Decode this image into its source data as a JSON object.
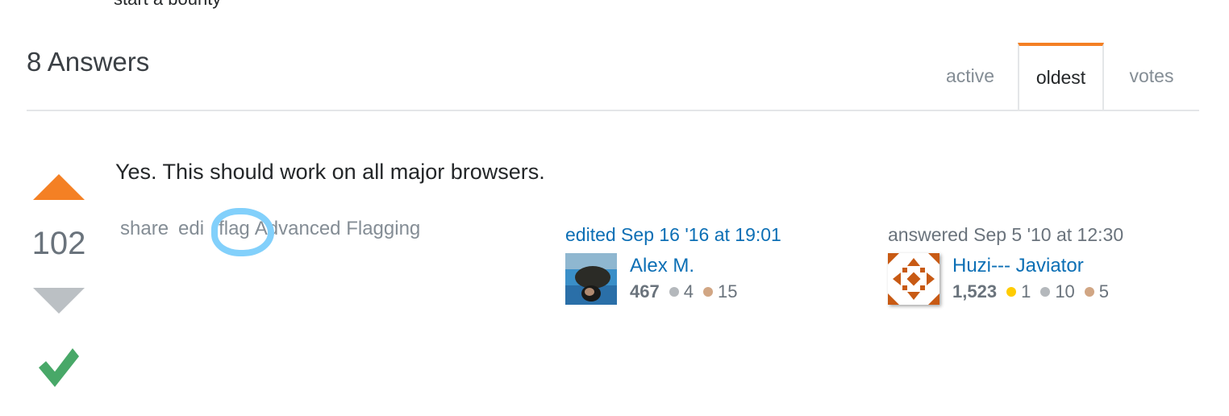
{
  "previous_text": "start a bounty",
  "answers_header": {
    "count_label": "8 Answers",
    "tabs": [
      {
        "label": "active",
        "selected": false
      },
      {
        "label": "oldest",
        "selected": true
      },
      {
        "label": "votes",
        "selected": false
      }
    ],
    "accent_color": "#f48024"
  },
  "answer": {
    "vote_count": "102",
    "accepted": true,
    "body": "Yes. This should work on all major browsers.",
    "menu": {
      "share": "share",
      "edit": "edi",
      "flag": "flag",
      "advanced_flagging": "Advanced Flagging"
    },
    "editor": {
      "action": "edited Sep 16 '16 at 19:01",
      "name": "Alex M.",
      "reputation": "467",
      "badges": {
        "silver": "4",
        "bronze": "15"
      }
    },
    "author": {
      "action": "answered Sep 5 '10 at 12:30",
      "name": "Huzi--- Javiator",
      "reputation": "1,523",
      "badges": {
        "gold": "1",
        "silver": "10",
        "bronze": "5"
      }
    }
  },
  "colors": {
    "link": "#0c6fb5",
    "gold": "#ffcc01",
    "silver": "#b4b8bc",
    "bronze": "#d1a684",
    "accepted": "#48a868",
    "highlight": "#82d0fb"
  }
}
